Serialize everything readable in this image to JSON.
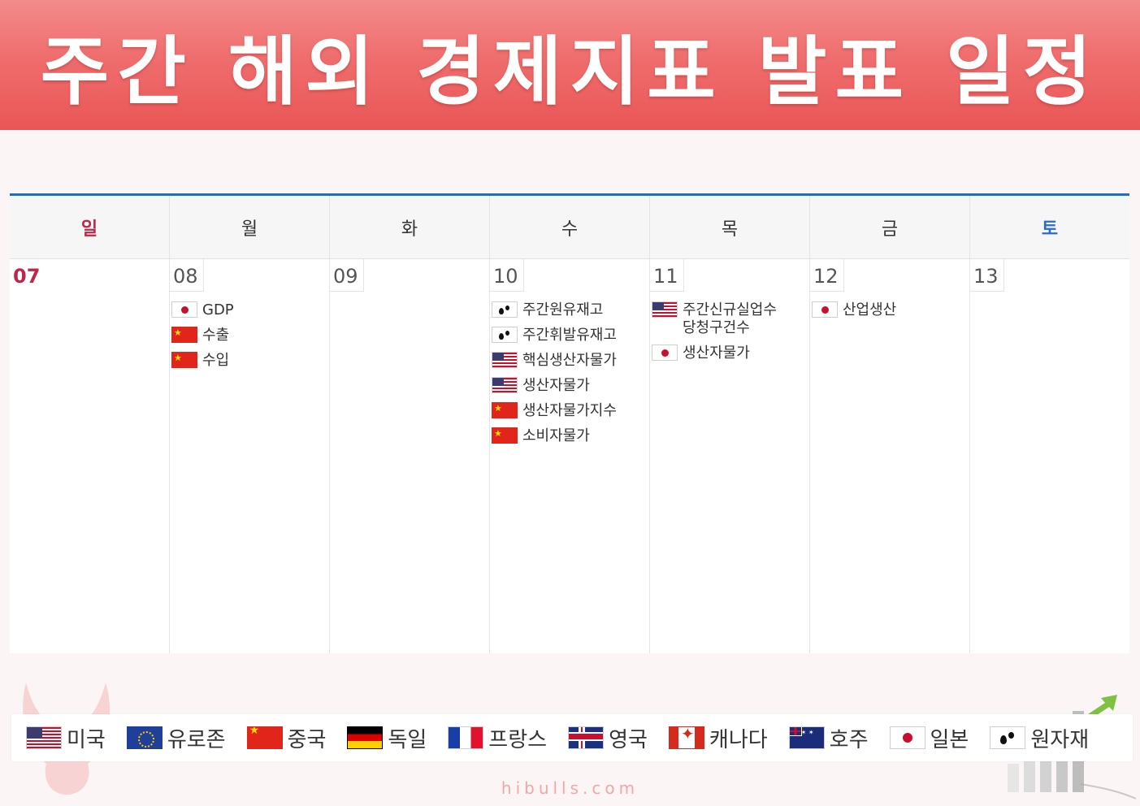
{
  "banner": {
    "title": "주간 해외 경제지표 발표 일정"
  },
  "calendar": {
    "weekdays": [
      "일",
      "월",
      "화",
      "수",
      "목",
      "금",
      "토"
    ],
    "days": [
      {
        "date": "07",
        "events": []
      },
      {
        "date": "08",
        "events": [
          {
            "flag": "jp",
            "label": "GDP"
          },
          {
            "flag": "cn",
            "label": "수출"
          },
          {
            "flag": "cn",
            "label": "수입"
          }
        ]
      },
      {
        "date": "09",
        "events": []
      },
      {
        "date": "10",
        "events": [
          {
            "flag": "oil",
            "label": "주간원유재고"
          },
          {
            "flag": "oil",
            "label": "주간휘발유재고"
          },
          {
            "flag": "us",
            "label": "핵심생산자물가"
          },
          {
            "flag": "us",
            "label": "생산자물가"
          },
          {
            "flag": "cn",
            "label": "생산자물가지수"
          },
          {
            "flag": "cn",
            "label": "소비자물가"
          }
        ]
      },
      {
        "date": "11",
        "events": [
          {
            "flag": "us",
            "label": "주간신규실업수\n당청구건수"
          },
          {
            "flag": "jp",
            "label": "생산자물가"
          }
        ]
      },
      {
        "date": "12",
        "events": [
          {
            "flag": "jp",
            "label": "산업생산"
          }
        ]
      },
      {
        "date": "13",
        "events": []
      }
    ]
  },
  "legend": [
    {
      "flag": "us",
      "label": "미국"
    },
    {
      "flag": "eu",
      "label": "유로존"
    },
    {
      "flag": "cn",
      "label": "중국"
    },
    {
      "flag": "de",
      "label": "독일"
    },
    {
      "flag": "fr",
      "label": "프랑스"
    },
    {
      "flag": "uk",
      "label": "영국"
    },
    {
      "flag": "ca",
      "label": "캐나다"
    },
    {
      "flag": "au",
      "label": "호주"
    },
    {
      "flag": "jp",
      "label": "일본"
    },
    {
      "flag": "oil",
      "label": "원자재"
    }
  ],
  "footer": {
    "watermark": "hibulls.com"
  },
  "colors": {
    "banner": "#ef6d6d",
    "sunday": "#c0264a",
    "saturday": "#2a6ec3",
    "calendar_top_border": "#1d6fc0"
  }
}
